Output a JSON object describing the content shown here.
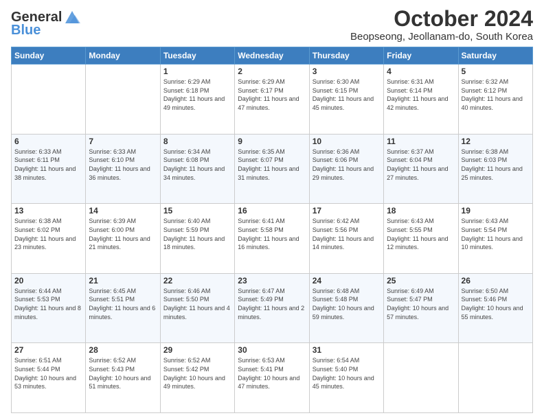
{
  "logo": {
    "general": "General",
    "blue": "Blue",
    "icon_color": "#4a90d9"
  },
  "title": "October 2024",
  "subtitle": "Beopseong, Jeollanam-do, South Korea",
  "days_of_week": [
    "Sunday",
    "Monday",
    "Tuesday",
    "Wednesday",
    "Thursday",
    "Friday",
    "Saturday"
  ],
  "weeks": [
    [
      {
        "day": null,
        "sunrise": null,
        "sunset": null,
        "daylight": null
      },
      {
        "day": null,
        "sunrise": null,
        "sunset": null,
        "daylight": null
      },
      {
        "day": "1",
        "sunrise": "Sunrise: 6:29 AM",
        "sunset": "Sunset: 6:18 PM",
        "daylight": "Daylight: 11 hours and 49 minutes."
      },
      {
        "day": "2",
        "sunrise": "Sunrise: 6:29 AM",
        "sunset": "Sunset: 6:17 PM",
        "daylight": "Daylight: 11 hours and 47 minutes."
      },
      {
        "day": "3",
        "sunrise": "Sunrise: 6:30 AM",
        "sunset": "Sunset: 6:15 PM",
        "daylight": "Daylight: 11 hours and 45 minutes."
      },
      {
        "day": "4",
        "sunrise": "Sunrise: 6:31 AM",
        "sunset": "Sunset: 6:14 PM",
        "daylight": "Daylight: 11 hours and 42 minutes."
      },
      {
        "day": "5",
        "sunrise": "Sunrise: 6:32 AM",
        "sunset": "Sunset: 6:12 PM",
        "daylight": "Daylight: 11 hours and 40 minutes."
      }
    ],
    [
      {
        "day": "6",
        "sunrise": "Sunrise: 6:33 AM",
        "sunset": "Sunset: 6:11 PM",
        "daylight": "Daylight: 11 hours and 38 minutes."
      },
      {
        "day": "7",
        "sunrise": "Sunrise: 6:33 AM",
        "sunset": "Sunset: 6:10 PM",
        "daylight": "Daylight: 11 hours and 36 minutes."
      },
      {
        "day": "8",
        "sunrise": "Sunrise: 6:34 AM",
        "sunset": "Sunset: 6:08 PM",
        "daylight": "Daylight: 11 hours and 34 minutes."
      },
      {
        "day": "9",
        "sunrise": "Sunrise: 6:35 AM",
        "sunset": "Sunset: 6:07 PM",
        "daylight": "Daylight: 11 hours and 31 minutes."
      },
      {
        "day": "10",
        "sunrise": "Sunrise: 6:36 AM",
        "sunset": "Sunset: 6:06 PM",
        "daylight": "Daylight: 11 hours and 29 minutes."
      },
      {
        "day": "11",
        "sunrise": "Sunrise: 6:37 AM",
        "sunset": "Sunset: 6:04 PM",
        "daylight": "Daylight: 11 hours and 27 minutes."
      },
      {
        "day": "12",
        "sunrise": "Sunrise: 6:38 AM",
        "sunset": "Sunset: 6:03 PM",
        "daylight": "Daylight: 11 hours and 25 minutes."
      }
    ],
    [
      {
        "day": "13",
        "sunrise": "Sunrise: 6:38 AM",
        "sunset": "Sunset: 6:02 PM",
        "daylight": "Daylight: 11 hours and 23 minutes."
      },
      {
        "day": "14",
        "sunrise": "Sunrise: 6:39 AM",
        "sunset": "Sunset: 6:00 PM",
        "daylight": "Daylight: 11 hours and 21 minutes."
      },
      {
        "day": "15",
        "sunrise": "Sunrise: 6:40 AM",
        "sunset": "Sunset: 5:59 PM",
        "daylight": "Daylight: 11 hours and 18 minutes."
      },
      {
        "day": "16",
        "sunrise": "Sunrise: 6:41 AM",
        "sunset": "Sunset: 5:58 PM",
        "daylight": "Daylight: 11 hours and 16 minutes."
      },
      {
        "day": "17",
        "sunrise": "Sunrise: 6:42 AM",
        "sunset": "Sunset: 5:56 PM",
        "daylight": "Daylight: 11 hours and 14 minutes."
      },
      {
        "day": "18",
        "sunrise": "Sunrise: 6:43 AM",
        "sunset": "Sunset: 5:55 PM",
        "daylight": "Daylight: 11 hours and 12 minutes."
      },
      {
        "day": "19",
        "sunrise": "Sunrise: 6:43 AM",
        "sunset": "Sunset: 5:54 PM",
        "daylight": "Daylight: 11 hours and 10 minutes."
      }
    ],
    [
      {
        "day": "20",
        "sunrise": "Sunrise: 6:44 AM",
        "sunset": "Sunset: 5:53 PM",
        "daylight": "Daylight: 11 hours and 8 minutes."
      },
      {
        "day": "21",
        "sunrise": "Sunrise: 6:45 AM",
        "sunset": "Sunset: 5:51 PM",
        "daylight": "Daylight: 11 hours and 6 minutes."
      },
      {
        "day": "22",
        "sunrise": "Sunrise: 6:46 AM",
        "sunset": "Sunset: 5:50 PM",
        "daylight": "Daylight: 11 hours and 4 minutes."
      },
      {
        "day": "23",
        "sunrise": "Sunrise: 6:47 AM",
        "sunset": "Sunset: 5:49 PM",
        "daylight": "Daylight: 11 hours and 2 minutes."
      },
      {
        "day": "24",
        "sunrise": "Sunrise: 6:48 AM",
        "sunset": "Sunset: 5:48 PM",
        "daylight": "Daylight: 10 hours and 59 minutes."
      },
      {
        "day": "25",
        "sunrise": "Sunrise: 6:49 AM",
        "sunset": "Sunset: 5:47 PM",
        "daylight": "Daylight: 10 hours and 57 minutes."
      },
      {
        "day": "26",
        "sunrise": "Sunrise: 6:50 AM",
        "sunset": "Sunset: 5:46 PM",
        "daylight": "Daylight: 10 hours and 55 minutes."
      }
    ],
    [
      {
        "day": "27",
        "sunrise": "Sunrise: 6:51 AM",
        "sunset": "Sunset: 5:44 PM",
        "daylight": "Daylight: 10 hours and 53 minutes."
      },
      {
        "day": "28",
        "sunrise": "Sunrise: 6:52 AM",
        "sunset": "Sunset: 5:43 PM",
        "daylight": "Daylight: 10 hours and 51 minutes."
      },
      {
        "day": "29",
        "sunrise": "Sunrise: 6:52 AM",
        "sunset": "Sunset: 5:42 PM",
        "daylight": "Daylight: 10 hours and 49 minutes."
      },
      {
        "day": "30",
        "sunrise": "Sunrise: 6:53 AM",
        "sunset": "Sunset: 5:41 PM",
        "daylight": "Daylight: 10 hours and 47 minutes."
      },
      {
        "day": "31",
        "sunrise": "Sunrise: 6:54 AM",
        "sunset": "Sunset: 5:40 PM",
        "daylight": "Daylight: 10 hours and 45 minutes."
      },
      {
        "day": null,
        "sunrise": null,
        "sunset": null,
        "daylight": null
      },
      {
        "day": null,
        "sunrise": null,
        "sunset": null,
        "daylight": null
      }
    ]
  ]
}
